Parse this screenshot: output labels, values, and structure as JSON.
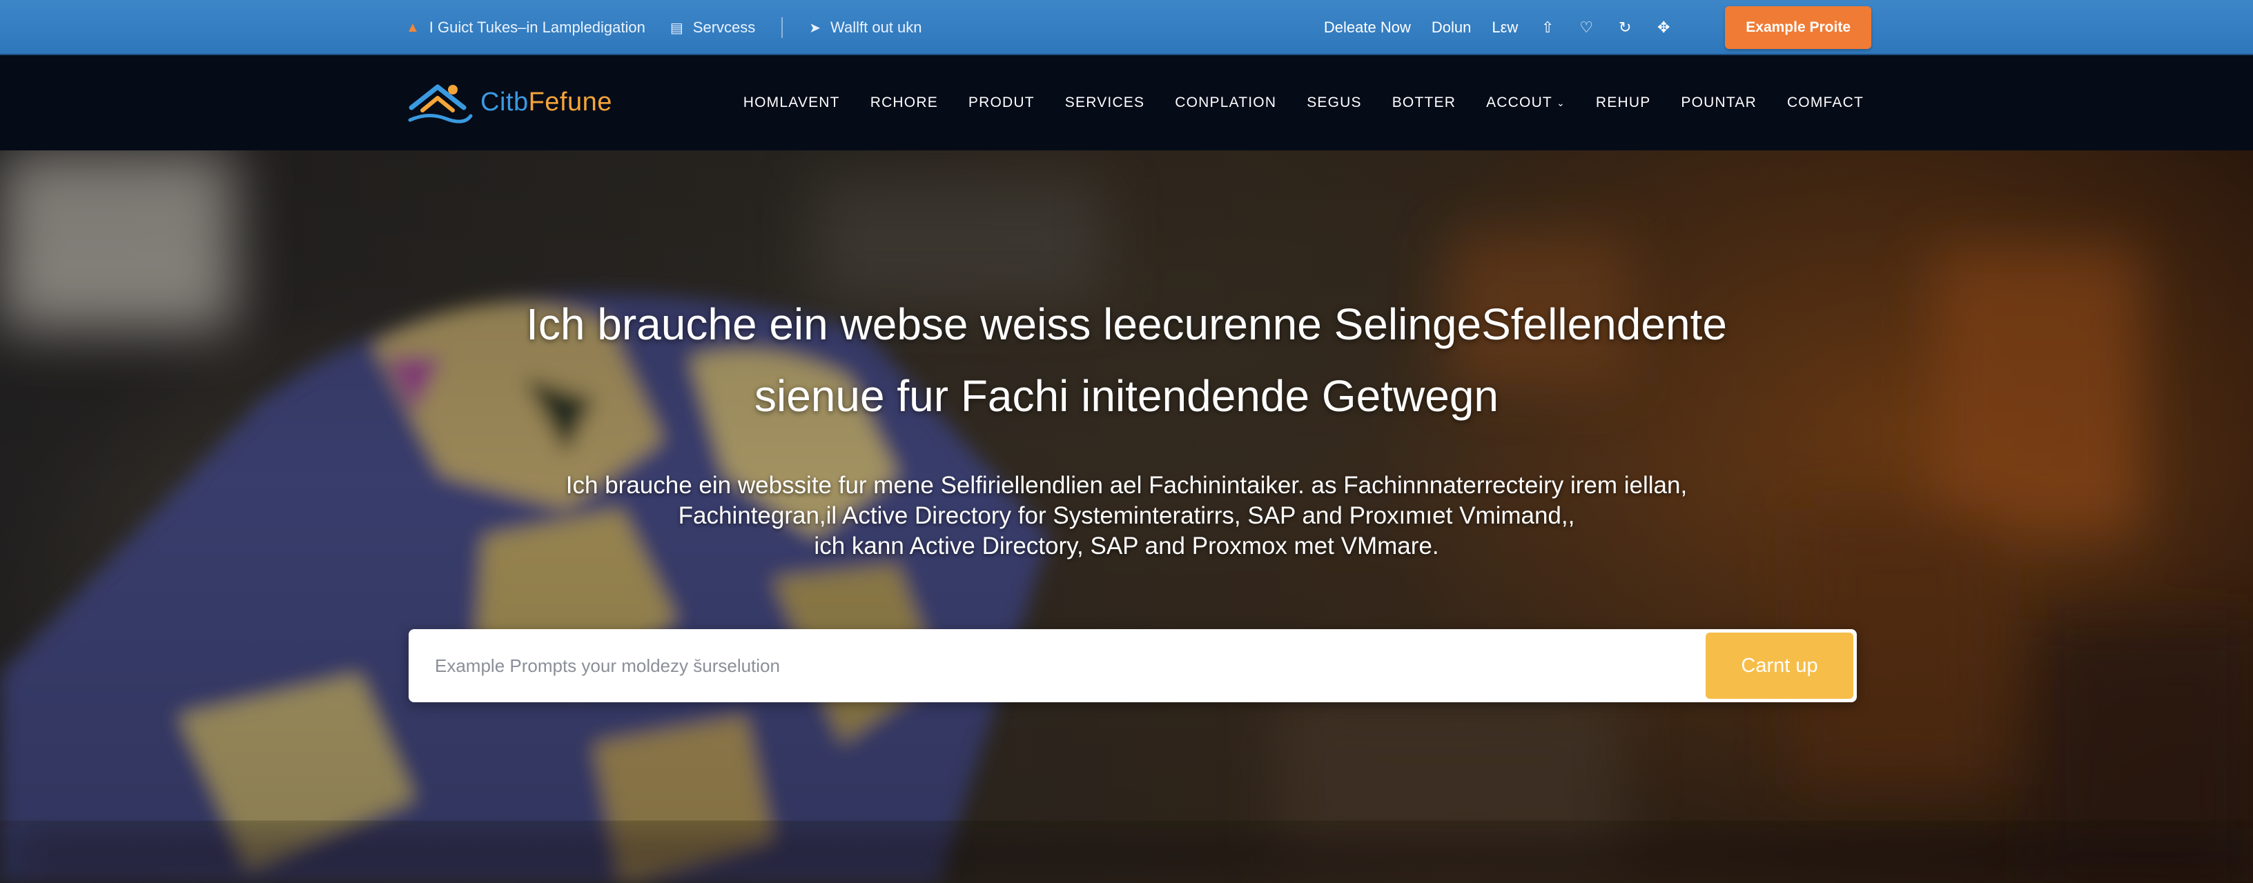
{
  "topbar": {
    "items": [
      {
        "icon": "flame-icon",
        "label": "I  Guict Tukes–in Lampledigation"
      },
      {
        "icon": "chart-icon",
        "label": "Servcess"
      },
      {
        "icon": "pin-icon",
        "label": "Wallft out ukn"
      }
    ],
    "links": [
      "Deleate Now",
      "Dolun",
      "Lεw"
    ],
    "icons": [
      "thumbs-up-icon",
      "heart-icon",
      "refresh-icon",
      "crosshair-icon"
    ],
    "cta_label": "Example Proite",
    "colors": {
      "bar": "#2f77bb",
      "cta": "#f07b35"
    }
  },
  "nav": {
    "logo": {
      "part1": "Citb",
      "part2": "Fefune"
    },
    "links": [
      {
        "label": "HOMLAVENT"
      },
      {
        "label": "RCHORE"
      },
      {
        "label": "PRODUT"
      },
      {
        "label": "SERVICES"
      },
      {
        "label": "CONPLATION"
      },
      {
        "label": "SEGUS"
      },
      {
        "label": "BOTTER"
      },
      {
        "label": "ACCOUT",
        "has_dropdown": true
      },
      {
        "label": "REHUP"
      },
      {
        "label": "POUNTAR"
      },
      {
        "label": "COMFACT"
      }
    ],
    "colors": {
      "background": "#060b18",
      "logo_primary": "#3a9ae0",
      "logo_accent": "#f4a53a"
    }
  },
  "hero": {
    "title_lines": [
      "Ich brauche ein webse weiss leecurenne SelingeSfellendente",
      "sienue fur  Fachi initendende Getwegn"
    ],
    "subtitle_lines": [
      "Ich brauche ein webssite fur mene Selfiriellendlien ael Fachinintaiker. as Fachinnnaterrecteiry irem iellan,",
      "Fachintegran,il Active Directory for Systeminteratirrs, SAP and Proxımıet Vmimand,,",
      "ich kann Active Directory, SAP and Proxmox met VMmare."
    ],
    "search": {
      "placeholder": "Example Prompts your moldezy s̆urselution",
      "button_label": "Carnt up",
      "button_color": "#f7bd49"
    }
  }
}
